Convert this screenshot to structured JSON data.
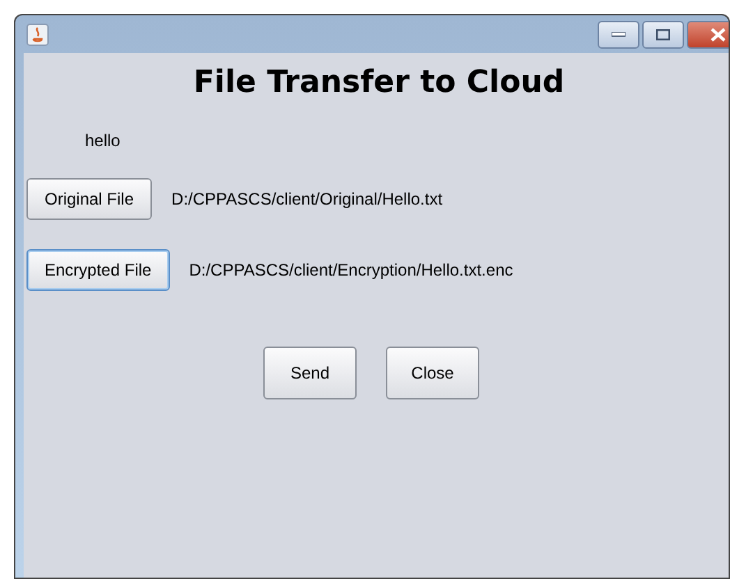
{
  "window": {
    "controls": [
      {
        "kind": "minimize"
      },
      {
        "kind": "maximize"
      },
      {
        "kind": "close"
      }
    ]
  },
  "heading": "File Transfer to Cloud",
  "message": "hello",
  "file_rows": [
    {
      "button": "Original File",
      "focused": false,
      "path": "D:/CPPASCS/client/Original/Hello.txt"
    },
    {
      "button": "Encrypted File",
      "focused": true,
      "path": "D:/CPPASCS/client/Encryption/Hello.txt.enc"
    }
  ],
  "actions": [
    {
      "label": "Send",
      "focused": false
    },
    {
      "label": "Close",
      "focused": false
    }
  ]
}
